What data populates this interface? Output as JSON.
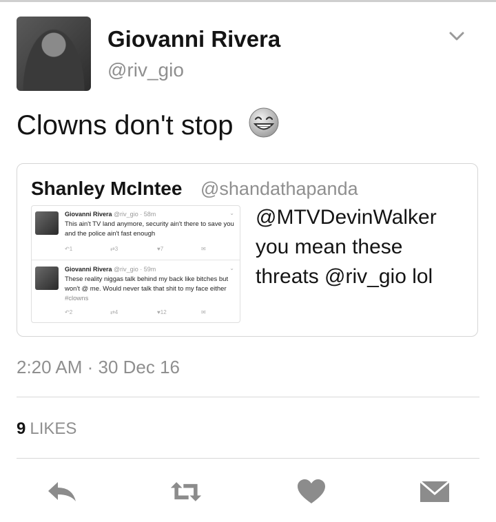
{
  "tweet": {
    "author_name": "Giovanni Rivera",
    "author_handle": "@riv_gio",
    "text": "Clowns don't stop",
    "timestamp": "2:20 AM · 30 Dec 16",
    "likes_count": "9",
    "likes_label": "LIKES"
  },
  "quoted_tweet": {
    "author_name": "Shanley McIntee",
    "author_handle": "@shandathapanda",
    "text": "@MTVDevinWalker you mean these threats @riv_gio lol",
    "embedded_screenshot": [
      {
        "name": "Giovanni Rivera",
        "handle_time": "@riv_gio · 58m",
        "text": "This ain't TV land anymore, security ain't there to save you and the police ain't fast enough",
        "hashtag": "",
        "replies": "1",
        "retweets": "3",
        "likes": "7"
      },
      {
        "name": "Giovanni Rivera",
        "handle_time": "@riv_gio · 59m",
        "text": "These reality niggas talk behind my back like bitches but won't @ me. Would never talk that shit to my face either",
        "hashtag": "#clowns",
        "replies": "2",
        "retweets": "4",
        "likes": "12"
      }
    ]
  },
  "icons": {
    "caret": "chevron-down-icon",
    "emoji": "grinning-face-icon",
    "reply": "reply-icon",
    "retweet": "retweet-icon",
    "like": "heart-icon",
    "dm": "envelope-icon"
  },
  "colors": {
    "text_primary": "#141414",
    "text_secondary": "#8f8f8f",
    "icon_gray": "#8c8c8c",
    "border": "#d5d5d5"
  }
}
